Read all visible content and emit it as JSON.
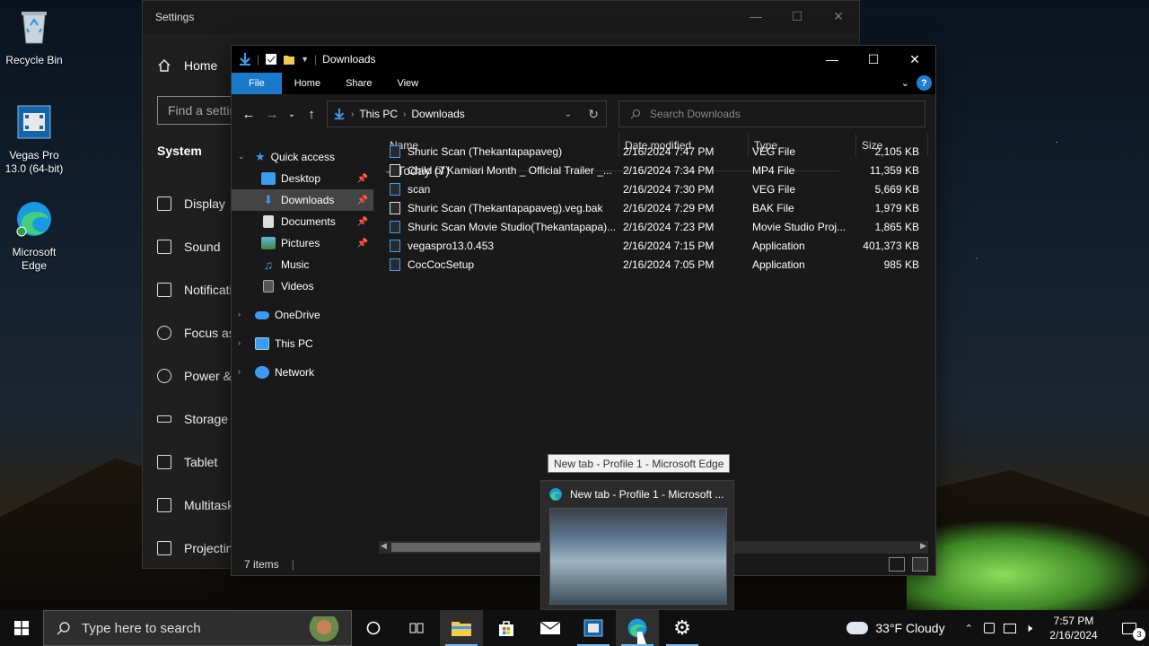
{
  "desktop": {
    "icons": [
      {
        "label": "Recycle Bin"
      },
      {
        "label": "Vegas Pro 13.0 (64-bit)"
      },
      {
        "label": "Microsoft Edge"
      }
    ]
  },
  "settings": {
    "title": "Settings",
    "home": "Home",
    "find_placeholder": "Find a setting",
    "section": "System",
    "nav": [
      "Display",
      "Sound",
      "Notifications & actions",
      "Focus assist",
      "Power & sleep",
      "Storage",
      "Tablet",
      "Multitasking",
      "Projecting to this PC"
    ]
  },
  "explorer": {
    "title": "Downloads",
    "ribbon_tabs": {
      "file": "File",
      "home": "Home",
      "share": "Share",
      "view": "View"
    },
    "help": "?",
    "breadcrumb": [
      "This PC",
      "Downloads"
    ],
    "search_placeholder": "Search Downloads",
    "nav": {
      "quick_access": "Quick access",
      "desktop": "Desktop",
      "downloads": "Downloads",
      "documents": "Documents",
      "pictures": "Pictures",
      "music": "Music",
      "videos": "Videos",
      "onedrive": "OneDrive",
      "this_pc": "This PC",
      "network": "Network"
    },
    "columns": {
      "name": "Name",
      "date": "Date modified",
      "type": "Type",
      "size": "Size"
    },
    "group": "Today (7)",
    "files": [
      {
        "name": "Shuric Scan (Thekantapapaveg)",
        "date": "2/16/2024 7:47 PM",
        "type": "VEG File",
        "size": "2,105 KB"
      },
      {
        "name": "Child of Kamiari Month _ Official Trailer _...",
        "date": "2/16/2024 7:34 PM",
        "type": "MP4 File",
        "size": "11,359 KB"
      },
      {
        "name": "scan",
        "date": "2/16/2024 7:30 PM",
        "type": "VEG File",
        "size": "5,669 KB"
      },
      {
        "name": "Shuric Scan (Thekantapapaveg).veg.bak",
        "date": "2/16/2024 7:29 PM",
        "type": "BAK File",
        "size": "1,979 KB"
      },
      {
        "name": "Shuric Scan Movie Studio(Thekantapapa)...",
        "date": "2/16/2024 7:23 PM",
        "type": "Movie Studio Proj...",
        "size": "1,865 KB"
      },
      {
        "name": "vegaspro13.0.453",
        "date": "2/16/2024 7:15 PM",
        "type": "Application",
        "size": "401,373 KB"
      },
      {
        "name": "CocCocSetup",
        "date": "2/16/2024 7:05 PM",
        "type": "Application",
        "size": "985 KB"
      }
    ],
    "status": "7 items"
  },
  "tooltip": "New tab - Profile 1 - Microsoft Edge",
  "preview_title": "New tab - Profile 1 - Microsoft ...",
  "taskbar": {
    "search_placeholder": "Type here to search",
    "weather": "33°F  Cloudy",
    "time": "7:57 PM",
    "date": "2/16/2024",
    "notifications": "3"
  },
  "colors": {
    "accent": "#1979ca",
    "taskbar": "#101010",
    "explorer_bg": "#191919"
  }
}
